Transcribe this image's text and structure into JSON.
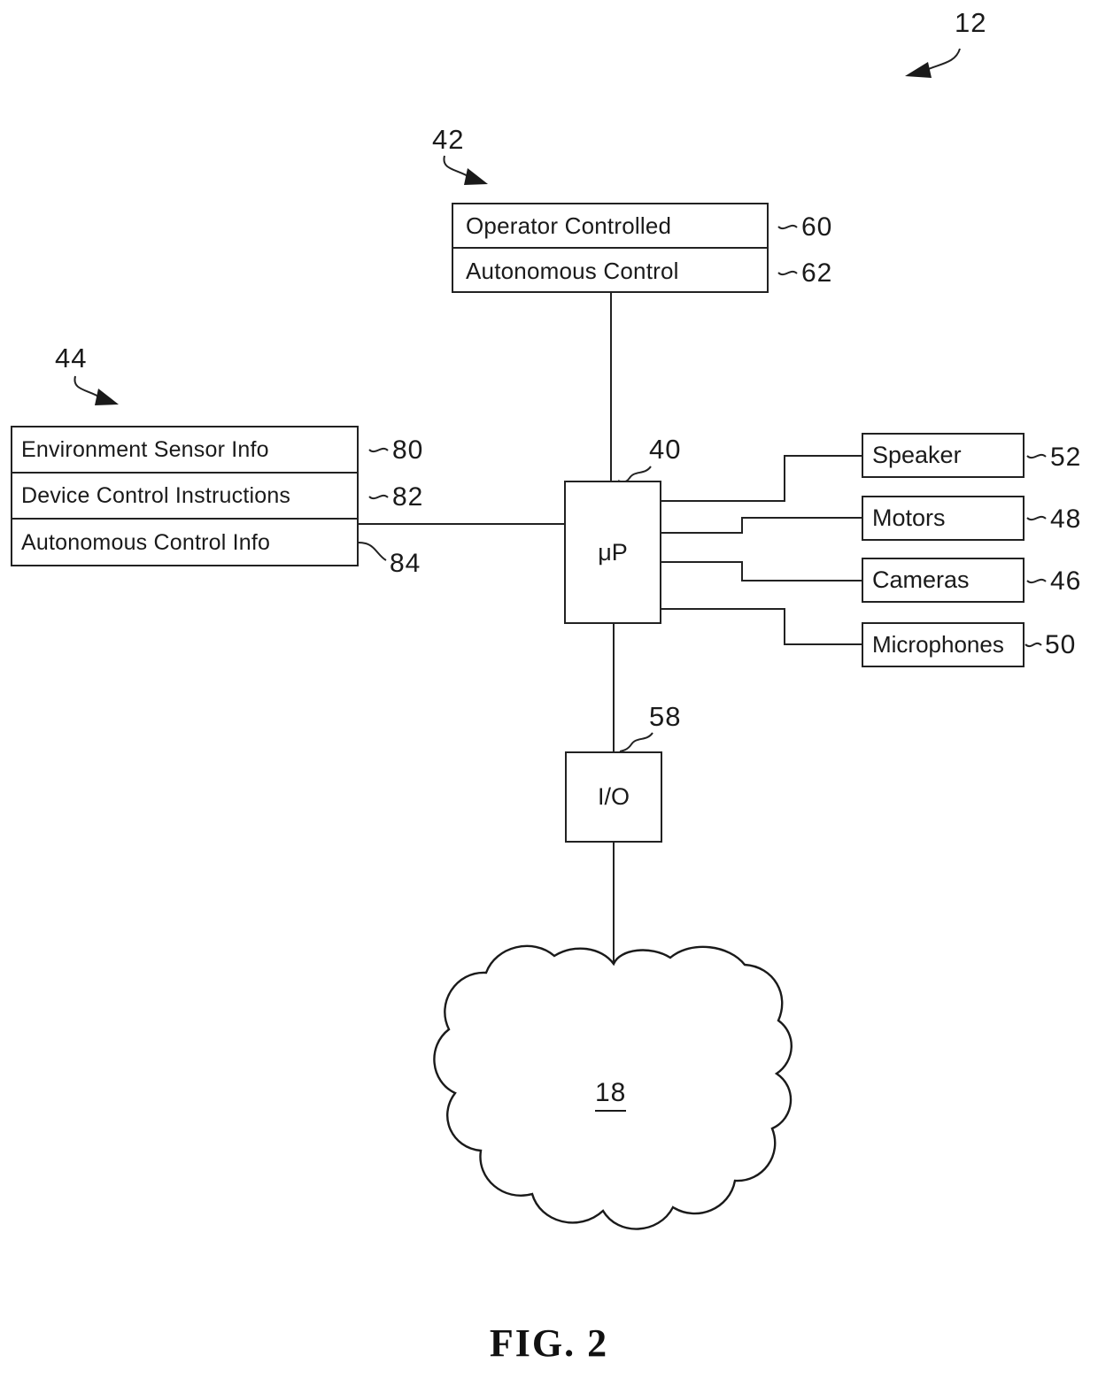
{
  "figure": {
    "caption": "FIG. 2",
    "system_ref": "12"
  },
  "blocks": {
    "control_modes": {
      "ref": "42",
      "rows": [
        {
          "label": "Operator Controlled",
          "ref": "60"
        },
        {
          "label": "Autonomous Control",
          "ref": "62"
        }
      ]
    },
    "memory_info": {
      "ref": "44",
      "rows": [
        {
          "label": "Environment Sensor Info",
          "ref": "80"
        },
        {
          "label": "Device Control Instructions",
          "ref": "82"
        },
        {
          "label": "Autonomous Control Info",
          "ref": "84"
        }
      ]
    },
    "processor": {
      "label": "μP",
      "ref": "40"
    },
    "io": {
      "label": "I/O",
      "ref": "58"
    },
    "peripherals": [
      {
        "label": "Speaker",
        "ref": "52"
      },
      {
        "label": "Motors",
        "ref": "48"
      },
      {
        "label": "Cameras",
        "ref": "46"
      },
      {
        "label": "Microphones",
        "ref": "50"
      }
    ],
    "network_cloud": {
      "label": "18"
    }
  },
  "colors": {
    "line": "#222222",
    "text": "#1a1a1a",
    "background": "#ffffff"
  }
}
